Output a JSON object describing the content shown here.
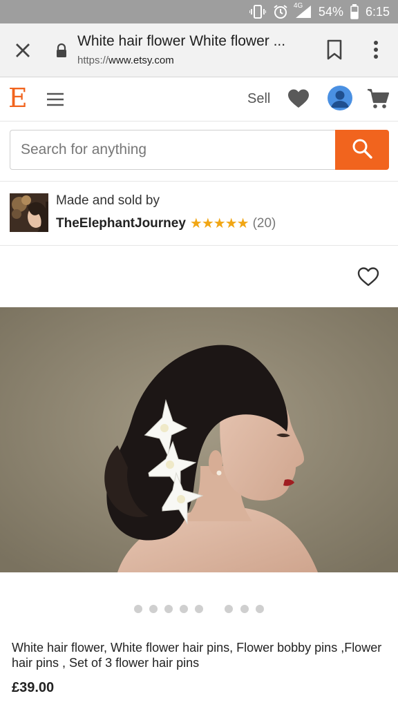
{
  "status_bar": {
    "network": "4G",
    "battery": "54%",
    "time": "6:15",
    "icons": [
      "vibrate-icon",
      "alarm-icon",
      "signal-icon",
      "battery-icon"
    ]
  },
  "browser": {
    "page_title": "White hair flower White flower ...",
    "url_scheme": "https://",
    "url_domain": "www.etsy.com",
    "icons": [
      "close-icon",
      "lock-icon",
      "bookmark-icon",
      "more-vert-icon"
    ]
  },
  "header": {
    "logo": "E",
    "sell_label": "Sell",
    "icons": [
      "menu-icon",
      "heart-icon",
      "avatar-icon",
      "cart-icon"
    ],
    "accent_color": "#f1641e"
  },
  "search": {
    "placeholder": "Search for anything",
    "value": ""
  },
  "seller": {
    "made_by_label": "Made and sold by",
    "shop_name": "TheElephantJourney",
    "stars": "★★★★★",
    "rating": 5,
    "review_count": "(20)"
  },
  "carousel": {
    "dot_count": 8
  },
  "listing": {
    "title": "White hair flower, White flower hair pins, Flower bobby pins ,Flower hair pins , Set of 3 flower hair pins",
    "price": "£39.00"
  }
}
